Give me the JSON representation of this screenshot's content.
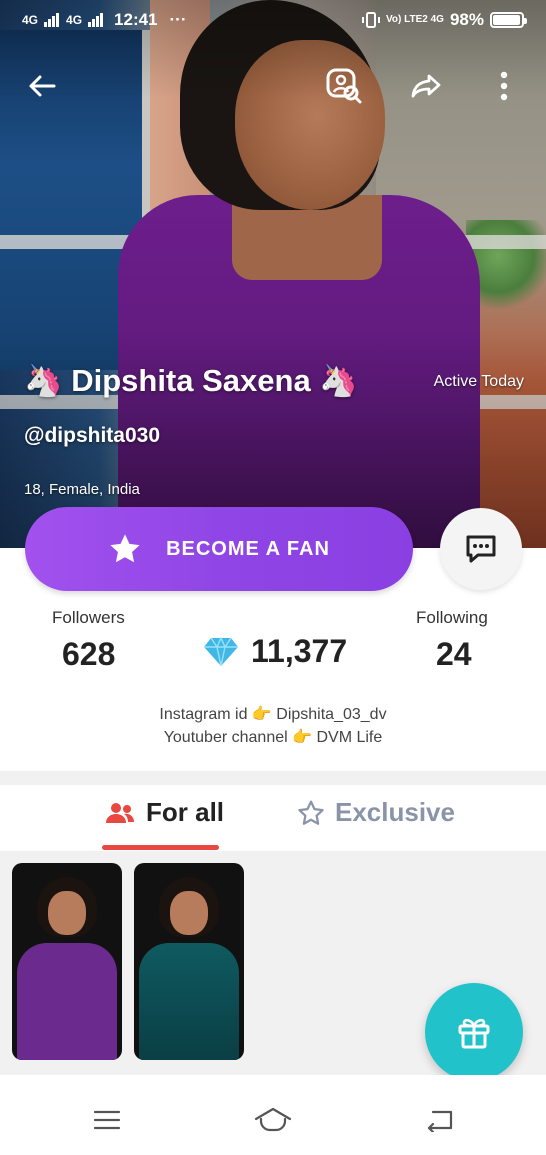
{
  "status_bar": {
    "network_left": "4G",
    "time": "12:41",
    "more": "···",
    "network_right": "Vo) LTE2 4G",
    "battery_percent": "98%",
    "battery_level": 0.98
  },
  "profile": {
    "name": "🦄 Dipshita Saxena 🦄",
    "active_status": "Active Today",
    "handle": "@dipshita030",
    "meta": "18, Female, India"
  },
  "actions": {
    "fan_button_label": "BECOME A FAN"
  },
  "stats": {
    "followers_label": "Followers",
    "followers_value": "628",
    "diamonds_value": "11,377",
    "following_label": "Following",
    "following_value": "24"
  },
  "bio": {
    "line1": "Instagram id 👉 Dipshita_03_dv",
    "line2": "Youtuber channel 👉 DVM Life"
  },
  "tabs": [
    {
      "label": "For all",
      "active": true
    },
    {
      "label": "Exclusive",
      "active": false
    }
  ],
  "colors": {
    "fan_button": "#9046e6",
    "tab_underline": "#e8483f",
    "gift_button": "#21c2c9",
    "diamond": "#3fb8e8",
    "inactive_tab": "#8a94a8"
  }
}
